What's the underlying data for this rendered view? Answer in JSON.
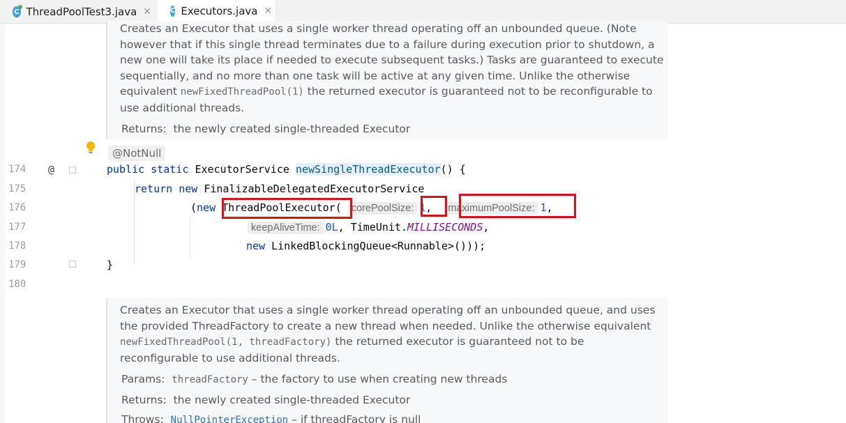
{
  "tabs": [
    {
      "label": "ThreadPoolTest3.java",
      "icon": "java-class-icon",
      "active": false
    },
    {
      "label": "Executors.java",
      "icon": "java-class-icon",
      "active": true
    }
  ],
  "doc1": {
    "line1": "Creates an Executor that uses a single worker thread operating off an unbounded queue. (Note",
    "line2": "however that if this single thread terminates due to a failure during execution prior to shutdown, a",
    "line3": "new one will take its place if needed to execute subsequent tasks.) Tasks are guaranteed to execute",
    "line4": "sequentially, and no more than one task will be active at any given time. Unlike the otherwise",
    "line5_pre": "equivalent ",
    "line5_code": "newFixedThreadPool(1)",
    "line5_post": " the returned executor is guaranteed not to be reconfigurable to",
    "line6": "use additional threads.",
    "returns_label": "Returns:",
    "returns_text": "the newly created single-threaded Executor"
  },
  "annotation": "@NotNull",
  "gutter": {
    "lines": [
      "174",
      "175",
      "176",
      "177",
      "178",
      "179",
      "180"
    ],
    "override_marker": "@"
  },
  "code": {
    "l174_kw1": "public",
    "l174_kw2": "static",
    "l174_type": "ExecutorService",
    "l174_method": "newSingleThreadExecutor",
    "l174_tail": "() {",
    "l175_kw": "return",
    "l175_kw2": "new",
    "l175_class": "FinalizableDelegatedExecutorService",
    "l176_open": "(",
    "l176_kw": "new",
    "l176_class": "ThreadPoolExecutor",
    "l176_paren": "(",
    "l176_hint1": "corePoolSize:",
    "l176_val1": "1",
    "l176_comma": ",",
    "l176_hint2": "maximumPoolSize:",
    "l176_val2": "1",
    "l176_comma2": ",",
    "l177_hint": "keepAliveTime:",
    "l177_val": "0L",
    "l177_mid": ", TimeUnit.",
    "l177_const": "MILLISECONDS",
    "l177_end": ",",
    "l178_kw": "new",
    "l178_rest": "LinkedBlockingQueue<Runnable>()));",
    "l179": "}"
  },
  "doc2": {
    "line1": "Creates an Executor that uses a single worker thread operating off an unbounded queue, and uses",
    "line2": "the provided ThreadFactory to create a new thread when needed. Unlike the otherwise equivalent",
    "line3_code": "newFixedThreadPool(1, threadFactory)",
    "line3_post": " the returned executor is guaranteed not to be",
    "line4": "reconfigurable to use additional threads.",
    "params_label": "Params:",
    "params_code": "threadFactory",
    "params_text": " – the factory to use when creating new threads",
    "returns_label": "Returns:",
    "returns_text": "the newly created single-threaded Executor",
    "throws_label": "Throws:",
    "throws_code": "NullPointerException",
    "throws_text": " – if threadFactory is null"
  },
  "colors": {
    "highlight_box": "#e0101a",
    "keyword": "#0033b3",
    "method": "#00627a",
    "number": "#1750eb",
    "constant": "#871094"
  }
}
